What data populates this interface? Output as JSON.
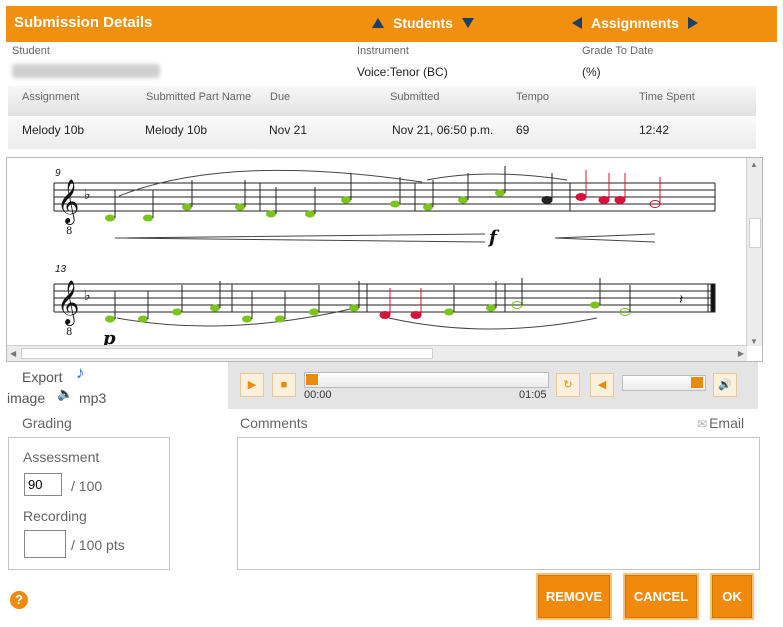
{
  "header": {
    "title": "Submission Details",
    "students_label": "Students",
    "assignments_label": "Assignments"
  },
  "info": {
    "student_label": "Student",
    "instrument_label": "Instrument",
    "instrument_value": "Voice:Tenor (BC)",
    "grade_label": "Grade To Date",
    "grade_value": "(%)"
  },
  "table": {
    "headers": [
      "Assignment",
      "Submitted Part Name",
      "Due",
      "Submitted",
      "Tempo",
      "Time Spent"
    ],
    "row": [
      "Melody 10b",
      "Melody 10b",
      "Nov 21",
      "Nov 21, 06:50 p.m.",
      "69",
      "12:42"
    ]
  },
  "score": {
    "measure_numbers": [
      "9",
      "13"
    ],
    "dynamics": [
      "f",
      "p"
    ]
  },
  "export": {
    "label": "Export",
    "image_label": "image",
    "mp3_label": "mp3"
  },
  "player": {
    "current_time": "00:00",
    "total_time": "01:05",
    "progress_fraction": 0.0,
    "volume_fraction": 1.0
  },
  "grading": {
    "title": "Grading",
    "assessment_label": "Assessment",
    "assessment_value": "90",
    "assessment_suffix": "/ 100",
    "recording_label": "Recording",
    "recording_value": "",
    "recording_suffix": "/ 100 pts"
  },
  "comments": {
    "title": "Comments",
    "email_label": "Email",
    "value": ""
  },
  "buttons": {
    "remove": "REMOVE",
    "cancel": "CANCEL",
    "ok": "OK",
    "help": "?"
  },
  "colors": {
    "accent": "#f0900e",
    "correct_note": "#7ac41c",
    "wrong_note": "#d4143c",
    "nav_arrow": "#1b3f66"
  }
}
